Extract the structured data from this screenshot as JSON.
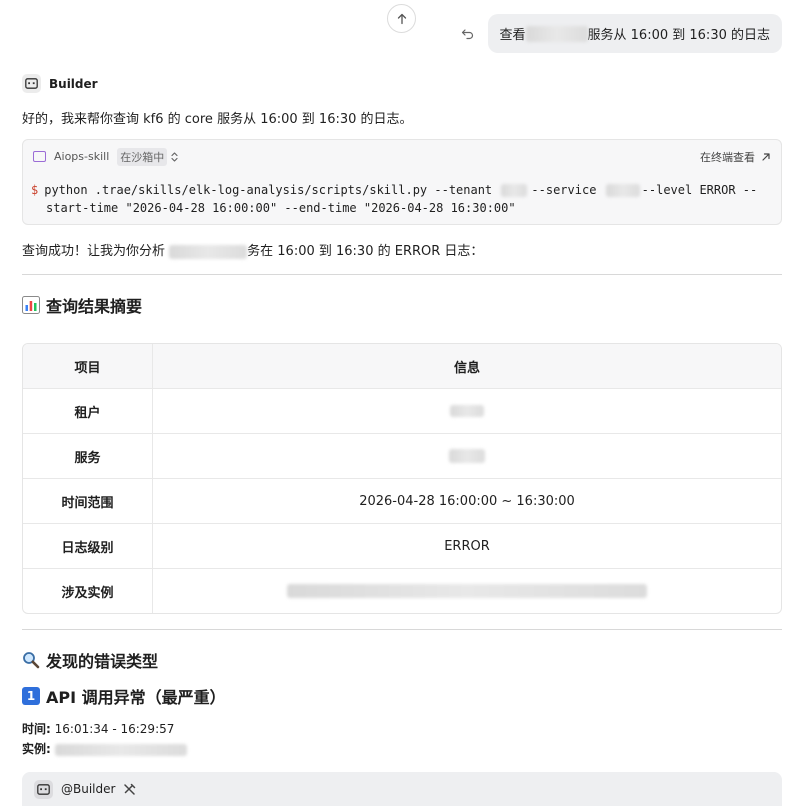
{
  "user_message": {
    "prefix": "查看 ",
    "suffix": "服务从 16:00 到 16:30 的日志"
  },
  "assistant": {
    "name": "Builder",
    "intro": "好的，我来帮你查询 kf6 的 core 服务从 16:00 到 16:30 的日志。"
  },
  "skill": {
    "name": "Aiops-skill",
    "status": "在沙箱中",
    "open_terminal": "在终端查看",
    "prompt": "$",
    "cmd_part1": "python .trae/skills/elk-log-analysis/scripts/skill.py --tenant ",
    "cmd_part2": "--service ",
    "cmd_part3": "--level ERROR --",
    "cmd_line2": "start-time \"2026-04-28 16:00:00\" --end-time \"2026-04-28 16:30:00\""
  },
  "result_text": {
    "prefix": "查询成功！让我为你分析 ",
    "suffix": "务在 16:00 到 16:30 的 ERROR 日志："
  },
  "summary": {
    "icon": "bar-chart-emoji",
    "title": "查询结果摘要",
    "table": {
      "headers": [
        "项目",
        "信息"
      ],
      "rows": [
        {
          "label": "租户",
          "value": ""
        },
        {
          "label": "服务",
          "value": ""
        },
        {
          "label": "时间范围",
          "value": "2026-04-28 16:00:00 ~ 16:30:00"
        },
        {
          "label": "日志级别",
          "value": "ERROR"
        },
        {
          "label": "涉及实例",
          "value": ""
        }
      ]
    }
  },
  "errors": {
    "icon": "magnifier-emoji",
    "title": "发现的错误类型",
    "first": {
      "number": "1",
      "title": "API 调用异常（最严重）",
      "time_label": "时间:",
      "time_value": " 16:01:34 - 16:29:57",
      "instance_label": "实例:"
    }
  },
  "bottom": {
    "mention": "@Builder"
  },
  "colors": {
    "accent_purple": "#9b6cd6",
    "dollar_red": "#c9402b",
    "number_blue": "#2f6fdb"
  }
}
